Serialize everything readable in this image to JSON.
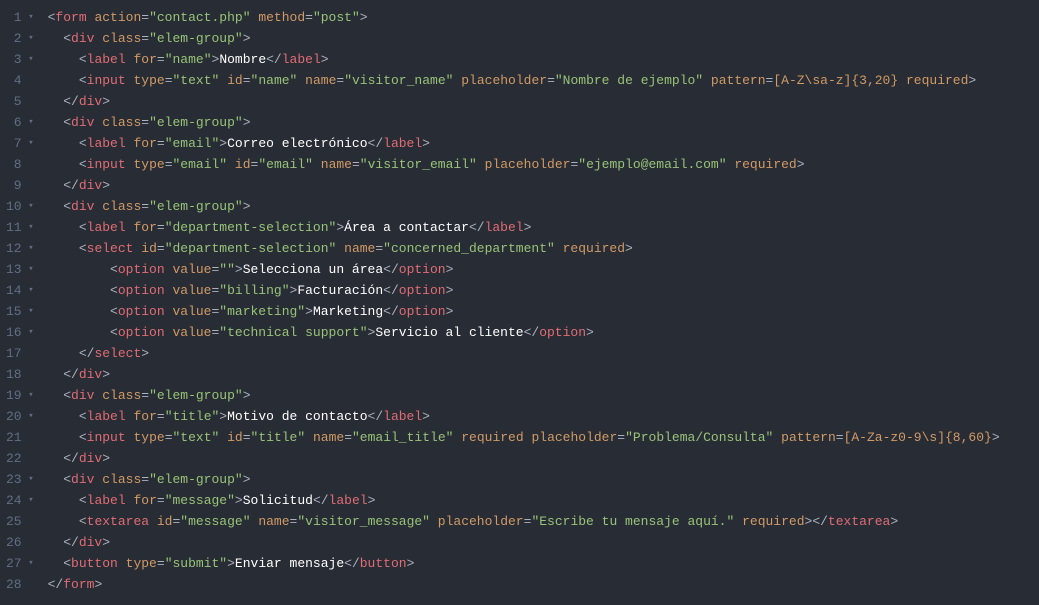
{
  "lines": [
    {
      "num": 1,
      "fold": true,
      "indent": 0,
      "tokens": [
        [
          "bracket",
          "<"
        ],
        [
          "tag",
          "form"
        ],
        [
          "bracket",
          " "
        ],
        [
          "attr",
          "action"
        ],
        [
          "eq",
          "="
        ],
        [
          "str",
          "\"contact.php\""
        ],
        [
          "bracket",
          " "
        ],
        [
          "attr",
          "method"
        ],
        [
          "eq",
          "="
        ],
        [
          "str",
          "\"post\""
        ],
        [
          "bracket",
          ">"
        ]
      ]
    },
    {
      "num": 2,
      "fold": true,
      "indent": 1,
      "tokens": [
        [
          "bracket",
          "<"
        ],
        [
          "tag",
          "div"
        ],
        [
          "bracket",
          " "
        ],
        [
          "attr",
          "class"
        ],
        [
          "eq",
          "="
        ],
        [
          "str",
          "\"elem-group\""
        ],
        [
          "bracket",
          ">"
        ]
      ]
    },
    {
      "num": 3,
      "fold": true,
      "indent": 2,
      "tokens": [
        [
          "bracket",
          "<"
        ],
        [
          "tag",
          "label"
        ],
        [
          "bracket",
          " "
        ],
        [
          "attr",
          "for"
        ],
        [
          "eq",
          "="
        ],
        [
          "str",
          "\"name\""
        ],
        [
          "bracket",
          ">"
        ],
        [
          "text",
          "Nombre"
        ],
        [
          "bracket",
          "</"
        ],
        [
          "tag",
          "label"
        ],
        [
          "bracket",
          ">"
        ]
      ]
    },
    {
      "num": 4,
      "fold": false,
      "indent": 2,
      "tokens": [
        [
          "bracket",
          "<"
        ],
        [
          "tag",
          "input"
        ],
        [
          "bracket",
          " "
        ],
        [
          "attr",
          "type"
        ],
        [
          "eq",
          "="
        ],
        [
          "str",
          "\"text\""
        ],
        [
          "bracket",
          " "
        ],
        [
          "attr",
          "id"
        ],
        [
          "eq",
          "="
        ],
        [
          "str",
          "\"name\""
        ],
        [
          "bracket",
          " "
        ],
        [
          "attr",
          "name"
        ],
        [
          "eq",
          "="
        ],
        [
          "str",
          "\"visitor_name\""
        ],
        [
          "bracket",
          " "
        ],
        [
          "attr",
          "placeholder"
        ],
        [
          "eq",
          "="
        ],
        [
          "str",
          "\"Nombre de ejemplo\""
        ],
        [
          "bracket",
          " "
        ],
        [
          "attr",
          "pattern"
        ],
        [
          "eq",
          "="
        ],
        [
          "attr",
          "[A-Z\\sa-z]{3,20}"
        ],
        [
          "bracket",
          " "
        ],
        [
          "attr",
          "required"
        ],
        [
          "bracket",
          ">"
        ]
      ]
    },
    {
      "num": 5,
      "fold": false,
      "indent": 1,
      "tokens": [
        [
          "bracket",
          "</"
        ],
        [
          "tag",
          "div"
        ],
        [
          "bracket",
          ">"
        ]
      ]
    },
    {
      "num": 6,
      "fold": true,
      "indent": 1,
      "tokens": [
        [
          "bracket",
          "<"
        ],
        [
          "tag",
          "div"
        ],
        [
          "bracket",
          " "
        ],
        [
          "attr",
          "class"
        ],
        [
          "eq",
          "="
        ],
        [
          "str",
          "\"elem-group\""
        ],
        [
          "bracket",
          ">"
        ]
      ]
    },
    {
      "num": 7,
      "fold": true,
      "indent": 2,
      "tokens": [
        [
          "bracket",
          "<"
        ],
        [
          "tag",
          "label"
        ],
        [
          "bracket",
          " "
        ],
        [
          "attr",
          "for"
        ],
        [
          "eq",
          "="
        ],
        [
          "str",
          "\"email\""
        ],
        [
          "bracket",
          ">"
        ],
        [
          "text",
          "Correo electrónico"
        ],
        [
          "bracket",
          "</"
        ],
        [
          "tag",
          "label"
        ],
        [
          "bracket",
          ">"
        ]
      ]
    },
    {
      "num": 8,
      "fold": false,
      "indent": 2,
      "tokens": [
        [
          "bracket",
          "<"
        ],
        [
          "tag",
          "input"
        ],
        [
          "bracket",
          " "
        ],
        [
          "attr",
          "type"
        ],
        [
          "eq",
          "="
        ],
        [
          "str",
          "\"email\""
        ],
        [
          "bracket",
          " "
        ],
        [
          "attr",
          "id"
        ],
        [
          "eq",
          "="
        ],
        [
          "str",
          "\"email\""
        ],
        [
          "bracket",
          " "
        ],
        [
          "attr",
          "name"
        ],
        [
          "eq",
          "="
        ],
        [
          "str",
          "\"visitor_email\""
        ],
        [
          "bracket",
          " "
        ],
        [
          "attr",
          "placeholder"
        ],
        [
          "eq",
          "="
        ],
        [
          "str",
          "\"ejemplo@email.com\""
        ],
        [
          "bracket",
          " "
        ],
        [
          "attr",
          "required"
        ],
        [
          "bracket",
          ">"
        ]
      ]
    },
    {
      "num": 9,
      "fold": false,
      "indent": 1,
      "tokens": [
        [
          "bracket",
          "</"
        ],
        [
          "tag",
          "div"
        ],
        [
          "bracket",
          ">"
        ]
      ]
    },
    {
      "num": 10,
      "fold": true,
      "indent": 1,
      "tokens": [
        [
          "bracket",
          "<"
        ],
        [
          "tag",
          "div"
        ],
        [
          "bracket",
          " "
        ],
        [
          "attr",
          "class"
        ],
        [
          "eq",
          "="
        ],
        [
          "str",
          "\"elem-group\""
        ],
        [
          "bracket",
          ">"
        ]
      ]
    },
    {
      "num": 11,
      "fold": true,
      "indent": 2,
      "tokens": [
        [
          "bracket",
          "<"
        ],
        [
          "tag",
          "label"
        ],
        [
          "bracket",
          " "
        ],
        [
          "attr",
          "for"
        ],
        [
          "eq",
          "="
        ],
        [
          "str",
          "\"department-selection\""
        ],
        [
          "bracket",
          ">"
        ],
        [
          "text",
          "Área a contactar"
        ],
        [
          "bracket",
          "</"
        ],
        [
          "tag",
          "label"
        ],
        [
          "bracket",
          ">"
        ]
      ]
    },
    {
      "num": 12,
      "fold": true,
      "indent": 2,
      "tokens": [
        [
          "bracket",
          "<"
        ],
        [
          "tag",
          "select"
        ],
        [
          "bracket",
          " "
        ],
        [
          "attr",
          "id"
        ],
        [
          "eq",
          "="
        ],
        [
          "str",
          "\"department-selection\""
        ],
        [
          "bracket",
          " "
        ],
        [
          "attr",
          "name"
        ],
        [
          "eq",
          "="
        ],
        [
          "str",
          "\"concerned_department\""
        ],
        [
          "bracket",
          " "
        ],
        [
          "attr",
          "required"
        ],
        [
          "bracket",
          ">"
        ]
      ]
    },
    {
      "num": 13,
      "fold": true,
      "indent": 4,
      "tokens": [
        [
          "bracket",
          "<"
        ],
        [
          "tag",
          "option"
        ],
        [
          "bracket",
          " "
        ],
        [
          "attr",
          "value"
        ],
        [
          "eq",
          "="
        ],
        [
          "str",
          "\"\""
        ],
        [
          "bracket",
          ">"
        ],
        [
          "text",
          "Selecciona un área"
        ],
        [
          "bracket",
          "</"
        ],
        [
          "tag",
          "option"
        ],
        [
          "bracket",
          ">"
        ]
      ]
    },
    {
      "num": 14,
      "fold": true,
      "indent": 4,
      "tokens": [
        [
          "bracket",
          "<"
        ],
        [
          "tag",
          "option"
        ],
        [
          "bracket",
          " "
        ],
        [
          "attr",
          "value"
        ],
        [
          "eq",
          "="
        ],
        [
          "str",
          "\"billing\""
        ],
        [
          "bracket",
          ">"
        ],
        [
          "text",
          "Facturación"
        ],
        [
          "bracket",
          "</"
        ],
        [
          "tag",
          "option"
        ],
        [
          "bracket",
          ">"
        ]
      ]
    },
    {
      "num": 15,
      "fold": true,
      "indent": 4,
      "tokens": [
        [
          "bracket",
          "<"
        ],
        [
          "tag",
          "option"
        ],
        [
          "bracket",
          " "
        ],
        [
          "attr",
          "value"
        ],
        [
          "eq",
          "="
        ],
        [
          "str",
          "\"marketing\""
        ],
        [
          "bracket",
          ">"
        ],
        [
          "text",
          "Marketing"
        ],
        [
          "bracket",
          "</"
        ],
        [
          "tag",
          "option"
        ],
        [
          "bracket",
          ">"
        ]
      ]
    },
    {
      "num": 16,
      "fold": true,
      "indent": 4,
      "tokens": [
        [
          "bracket",
          "<"
        ],
        [
          "tag",
          "option"
        ],
        [
          "bracket",
          " "
        ],
        [
          "attr",
          "value"
        ],
        [
          "eq",
          "="
        ],
        [
          "str",
          "\"technical support\""
        ],
        [
          "bracket",
          ">"
        ],
        [
          "text",
          "Servicio al cliente"
        ],
        [
          "bracket",
          "</"
        ],
        [
          "tag",
          "option"
        ],
        [
          "bracket",
          ">"
        ]
      ]
    },
    {
      "num": 17,
      "fold": false,
      "indent": 2,
      "tokens": [
        [
          "bracket",
          "</"
        ],
        [
          "tag",
          "select"
        ],
        [
          "bracket",
          ">"
        ]
      ]
    },
    {
      "num": 18,
      "fold": false,
      "indent": 1,
      "tokens": [
        [
          "bracket",
          "</"
        ],
        [
          "tag",
          "div"
        ],
        [
          "bracket",
          ">"
        ]
      ]
    },
    {
      "num": 19,
      "fold": true,
      "indent": 1,
      "tokens": [
        [
          "bracket",
          "<"
        ],
        [
          "tag",
          "div"
        ],
        [
          "bracket",
          " "
        ],
        [
          "attr",
          "class"
        ],
        [
          "eq",
          "="
        ],
        [
          "str",
          "\"elem-group\""
        ],
        [
          "bracket",
          ">"
        ]
      ]
    },
    {
      "num": 20,
      "fold": true,
      "indent": 2,
      "tokens": [
        [
          "bracket",
          "<"
        ],
        [
          "tag",
          "label"
        ],
        [
          "bracket",
          " "
        ],
        [
          "attr",
          "for"
        ],
        [
          "eq",
          "="
        ],
        [
          "str",
          "\"title\""
        ],
        [
          "bracket",
          ">"
        ],
        [
          "text",
          "Motivo de contacto"
        ],
        [
          "bracket",
          "</"
        ],
        [
          "tag",
          "label"
        ],
        [
          "bracket",
          ">"
        ]
      ]
    },
    {
      "num": 21,
      "fold": false,
      "indent": 2,
      "tokens": [
        [
          "bracket",
          "<"
        ],
        [
          "tag",
          "input"
        ],
        [
          "bracket",
          " "
        ],
        [
          "attr",
          "type"
        ],
        [
          "eq",
          "="
        ],
        [
          "str",
          "\"text\""
        ],
        [
          "bracket",
          " "
        ],
        [
          "attr",
          "id"
        ],
        [
          "eq",
          "="
        ],
        [
          "str",
          "\"title\""
        ],
        [
          "bracket",
          " "
        ],
        [
          "attr",
          "name"
        ],
        [
          "eq",
          "="
        ],
        [
          "str",
          "\"email_title\""
        ],
        [
          "bracket",
          " "
        ],
        [
          "attr",
          "required"
        ],
        [
          "bracket",
          " "
        ],
        [
          "attr",
          "placeholder"
        ],
        [
          "eq",
          "="
        ],
        [
          "str",
          "\"Problema/Consulta\""
        ],
        [
          "bracket",
          " "
        ],
        [
          "attr",
          "pattern"
        ],
        [
          "eq",
          "="
        ],
        [
          "attr",
          "[A-Za-z0-9\\s]{8,60}"
        ],
        [
          "bracket",
          ">"
        ]
      ]
    },
    {
      "num": 22,
      "fold": false,
      "indent": 1,
      "tokens": [
        [
          "bracket",
          "</"
        ],
        [
          "tag",
          "div"
        ],
        [
          "bracket",
          ">"
        ]
      ]
    },
    {
      "num": 23,
      "fold": true,
      "indent": 1,
      "tokens": [
        [
          "bracket",
          "<"
        ],
        [
          "tag",
          "div"
        ],
        [
          "bracket",
          " "
        ],
        [
          "attr",
          "class"
        ],
        [
          "eq",
          "="
        ],
        [
          "str",
          "\"elem-group\""
        ],
        [
          "bracket",
          ">"
        ]
      ]
    },
    {
      "num": 24,
      "fold": true,
      "indent": 2,
      "tokens": [
        [
          "bracket",
          "<"
        ],
        [
          "tag",
          "label"
        ],
        [
          "bracket",
          " "
        ],
        [
          "attr",
          "for"
        ],
        [
          "eq",
          "="
        ],
        [
          "str",
          "\"message\""
        ],
        [
          "bracket",
          ">"
        ],
        [
          "text",
          "Solicitud"
        ],
        [
          "bracket",
          "</"
        ],
        [
          "tag",
          "label"
        ],
        [
          "bracket",
          ">"
        ]
      ]
    },
    {
      "num": 25,
      "fold": false,
      "indent": 2,
      "tokens": [
        [
          "bracket",
          "<"
        ],
        [
          "tag",
          "textarea"
        ],
        [
          "bracket",
          " "
        ],
        [
          "attr",
          "id"
        ],
        [
          "eq",
          "="
        ],
        [
          "str",
          "\"message\""
        ],
        [
          "bracket",
          " "
        ],
        [
          "attr",
          "name"
        ],
        [
          "eq",
          "="
        ],
        [
          "str",
          "\"visitor_message\""
        ],
        [
          "bracket",
          " "
        ],
        [
          "attr",
          "placeholder"
        ],
        [
          "eq",
          "="
        ],
        [
          "str",
          "\"Escribe tu mensaje aquí.\""
        ],
        [
          "bracket",
          " "
        ],
        [
          "attr",
          "required"
        ],
        [
          "bracket",
          "></"
        ],
        [
          "tag",
          "textarea"
        ],
        [
          "bracket",
          ">"
        ]
      ]
    },
    {
      "num": 26,
      "fold": false,
      "indent": 1,
      "tokens": [
        [
          "bracket",
          "</"
        ],
        [
          "tag",
          "div"
        ],
        [
          "bracket",
          ">"
        ]
      ]
    },
    {
      "num": 27,
      "fold": true,
      "indent": 1,
      "tokens": [
        [
          "bracket",
          "<"
        ],
        [
          "tag",
          "button"
        ],
        [
          "bracket",
          " "
        ],
        [
          "attr",
          "type"
        ],
        [
          "eq",
          "="
        ],
        [
          "str",
          "\"submit\""
        ],
        [
          "bracket",
          ">"
        ],
        [
          "text",
          "Enviar mensaje"
        ],
        [
          "bracket",
          "</"
        ],
        [
          "tag",
          "button"
        ],
        [
          "bracket",
          ">"
        ]
      ]
    },
    {
      "num": 28,
      "fold": false,
      "indent": 0,
      "tokens": [
        [
          "bracket",
          "</"
        ],
        [
          "tag",
          "form"
        ],
        [
          "bracket",
          ">"
        ]
      ]
    }
  ],
  "indentUnit": "  ",
  "foldGlyph": "▾"
}
